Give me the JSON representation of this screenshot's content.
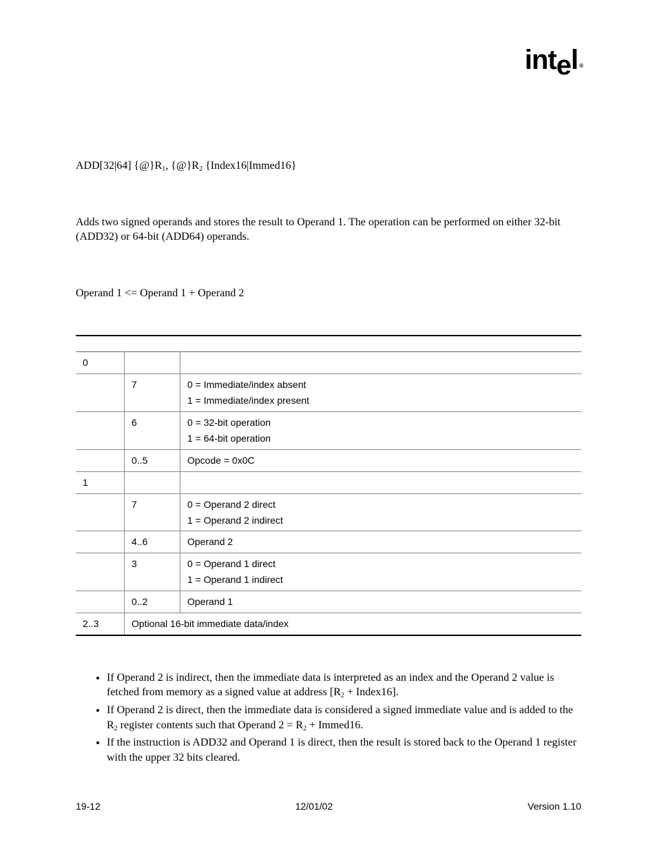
{
  "logo": {
    "text": "intel",
    "registered": "®"
  },
  "syntax": {
    "full": "ADD[32|64]  {@}R",
    "sub1": "1",
    "cont1": ", {@}R",
    "sub2": "2",
    "cont2": " {Index16|Immed16}"
  },
  "description": "Adds two signed operands and stores the result to Operand 1. The operation can be performed on either 32-bit (ADD32) or 64-bit (ADD64) operands.",
  "operation": "Operand 1 <= Operand 1 + Operand 2",
  "table": {
    "rows": [
      {
        "byte": "0",
        "bit": "",
        "desc": ""
      },
      {
        "byte": "",
        "bit": "7",
        "desc_a": "0 = Immediate/index absent",
        "desc_b": "1 = Immediate/index present"
      },
      {
        "byte": "",
        "bit": "6",
        "desc_a": "0 = 32-bit operation",
        "desc_b": "1 = 64-bit operation"
      },
      {
        "byte": "",
        "bit": "0..5",
        "desc": "Opcode = 0x0C"
      },
      {
        "byte": "1",
        "bit": "",
        "desc": ""
      },
      {
        "byte": "",
        "bit": "7",
        "desc_a": "0 = Operand 2 direct",
        "desc_b": "1 = Operand 2 indirect"
      },
      {
        "byte": "",
        "bit": "4..6",
        "desc": "Operand 2"
      },
      {
        "byte": "",
        "bit": "3",
        "desc_a": "0 = Operand 1 direct",
        "desc_b": "1 = Operand 1 indirect"
      },
      {
        "byte": "",
        "bit": "0..2",
        "desc": "Operand 1"
      },
      {
        "byte": "2..3",
        "bit_span": "Optional 16-bit immediate data/index"
      }
    ]
  },
  "bullets": [
    {
      "pre": "If Operand 2 is indirect, then the immediate data is interpreted as an index and the Operand 2 value is fetched from memory as a signed value at address [R",
      "sub": "2",
      "post": " + Index16]."
    },
    {
      "pre": "If Operand 2 is direct, then the immediate data is considered a signed immediate value and is added to the R",
      "sub": "2",
      "mid": " register contents such that Operand 2 = R",
      "sub2": "2",
      "post": " + Immed16."
    },
    {
      "pre": "If the instruction is ADD32 and Operand 1 is direct, then the result is stored back to the Operand 1 register with the upper 32 bits cleared.",
      "sub": "",
      "post": ""
    }
  ],
  "footer": {
    "left": "19-12",
    "center": "12/01/02",
    "right": "Version 1.10"
  }
}
